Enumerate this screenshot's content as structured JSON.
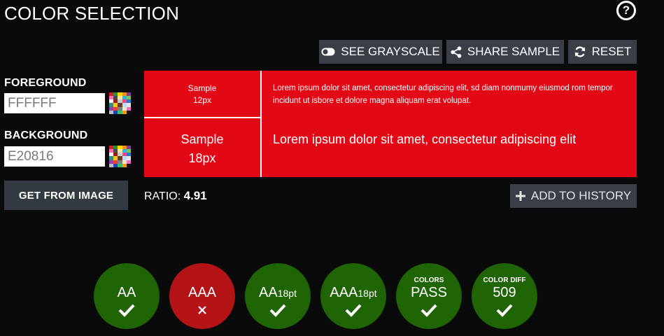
{
  "header": {
    "title": "COLOR SELECTION",
    "help_label": "?"
  },
  "toolbar": {
    "grayscale_label": "SEE GRAYSCALE",
    "share_label": "SHARE SAMPLE",
    "reset_label": "RESET"
  },
  "foreground": {
    "label": "FOREGROUND",
    "value": "FFFFFF",
    "color": "#FFFFFF"
  },
  "background": {
    "label": "BACKGROUND",
    "value": "E20816",
    "color": "#E20816"
  },
  "get_from_image_label": "GET FROM IMAGE",
  "sample": {
    "small_label_1": "Sample",
    "small_label_2": "12px",
    "large_label_1": "Sample",
    "large_label_2": "18px",
    "small_text": "Lorem ipsum dolor sit amet, consectetur adipiscing elit, sd diam nonmumy eiusmod rom tempor incidunt ut isbore et dolore magna aliquam erat volupat.",
    "large_text": "Lorem ipsum dolor sit amet, consectetur adipiscing elit"
  },
  "ratio": {
    "label": "RATIO:",
    "value": "4.91"
  },
  "add_history_label": "ADD TO HISTORY",
  "results": [
    {
      "caption": "",
      "label": "AA",
      "suffix": "",
      "pass": true
    },
    {
      "caption": "",
      "label": "AAA",
      "suffix": "",
      "pass": false
    },
    {
      "caption": "",
      "label": "AA",
      "suffix": "18pt",
      "pass": true
    },
    {
      "caption": "",
      "label": "AAA",
      "suffix": "18pt",
      "pass": true
    },
    {
      "caption": "COLORS",
      "label": "PASS",
      "suffix": "",
      "pass": true
    },
    {
      "caption": "COLOR DIFF",
      "label": "509",
      "suffix": "",
      "pass": true
    }
  ],
  "colors": {
    "pass": "#1f6405",
    "fail": "#b51416",
    "button": "#3a3f47",
    "page_bg": "#0a0a0a"
  }
}
